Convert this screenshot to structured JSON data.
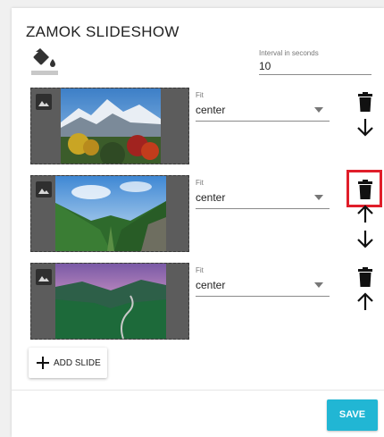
{
  "dialog": {
    "title": "ZAMOK SLIDESHOW",
    "paint_icon": "format-color-fill-icon",
    "interval": {
      "label": "Interval in seconds",
      "value": "10"
    }
  },
  "slides": [
    {
      "fit_label": "Fit",
      "fit_value": "center",
      "actions": [
        "delete-icon",
        "arrow-down-icon"
      ]
    },
    {
      "fit_label": "Fit",
      "fit_value": "center",
      "actions": [
        "delete-icon",
        "arrow-up-icon",
        "arrow-down-icon"
      ],
      "highlighted": "delete-icon"
    },
    {
      "fit_label": "Fit",
      "fit_value": "center",
      "actions": [
        "delete-icon",
        "arrow-up-icon"
      ]
    }
  ],
  "add_slide_label": "ADD SLIDE",
  "save_label": "SAVE",
  "colors": {
    "accent": "#21b6d4",
    "highlight": "#e01e2a",
    "placeholder": "#5c5c5c"
  }
}
